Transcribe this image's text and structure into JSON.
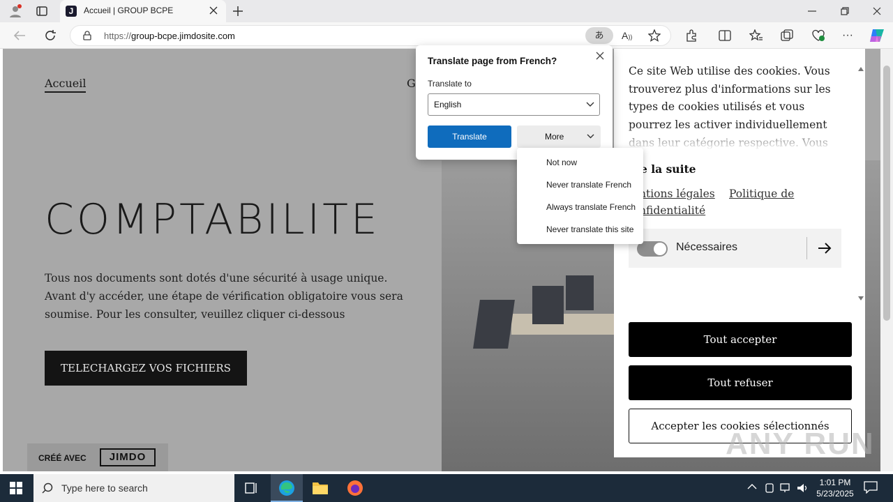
{
  "browser": {
    "tab_title": "Accueil | GROUP BCPE",
    "url_prefix": "https://",
    "url_host": "group-bcpe.jimdosite.com",
    "favicon_letter": "J"
  },
  "page": {
    "nav_home": "Accueil",
    "nav_partial": "G",
    "heading": "COMPTABILITE",
    "body_text": "Tous nos documents sont dotés d'une sécurité à usage unique. Avant d'y accéder, une étape de vérification obligatoire vous sera soumise. Pour les consulter, veuillez cliquer ci-dessous",
    "cta": "TELECHARGEZ VOS FICHIERS",
    "badge_prefix": "CRÉÉ AVEC",
    "badge_brand": "JIMDO"
  },
  "translate": {
    "title": "Translate page from French?",
    "translate_to_label": "Translate to",
    "language_value": "English",
    "translate_button": "Translate",
    "more_button": "More",
    "menu": [
      "Not now",
      "Never translate French",
      "Always translate French",
      "Never translate this site"
    ]
  },
  "cookie": {
    "text": "Ce site Web utilise des cookies. Vous trouverez plus d'informations sur les types de cookies utilisés et vous pourrez les activer individuellement dans leur catégorie respective. Vous pouvez",
    "read_more": "e la suite",
    "link_legal": "ntions légales",
    "link_privacy_1": "Politique de",
    "link_privacy_2": "nfidentialité",
    "toggle_label": "Nécessaires",
    "accept_all": "Tout accepter",
    "refuse_all": "Tout refuser",
    "accept_selected": "Accepter les cookies sélectionnés"
  },
  "taskbar": {
    "search_placeholder": "Type here to search",
    "time": "1:01 PM",
    "date": "5/23/2025"
  },
  "watermark": "ANY RUN"
}
